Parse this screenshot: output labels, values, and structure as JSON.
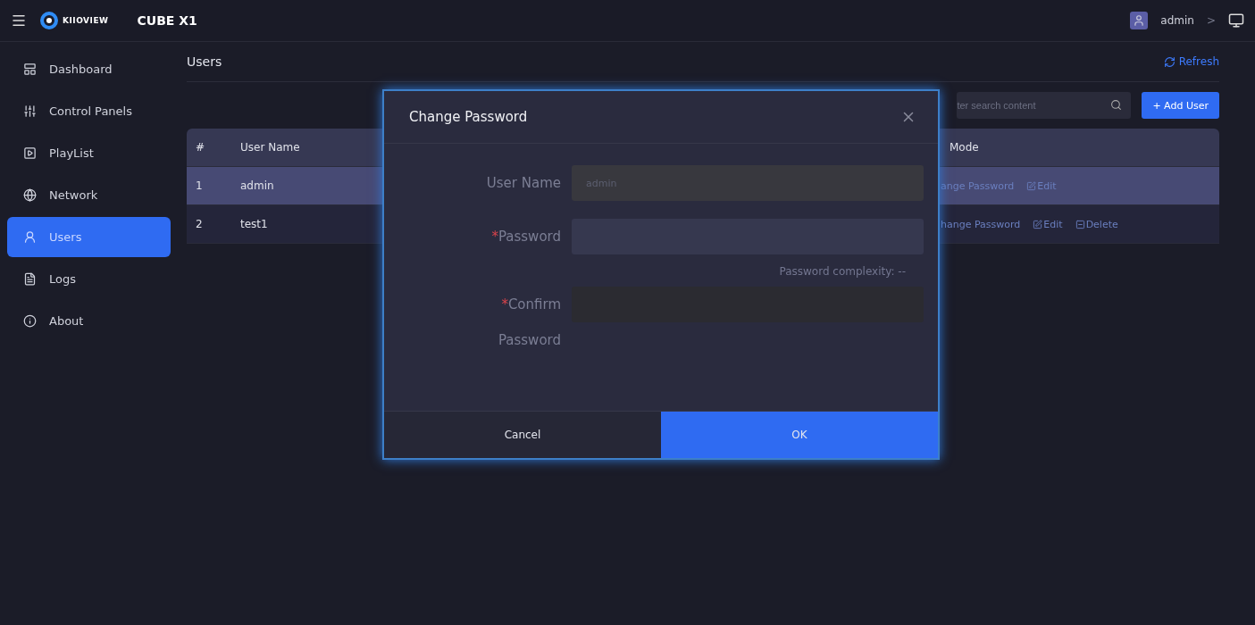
{
  "header": {
    "logo_text": "KIIOVIEW",
    "product": "CUBE X1",
    "user": "admin",
    "chevron": ">"
  },
  "sidebar": {
    "items": [
      {
        "label": "Dashboard",
        "selected": false
      },
      {
        "label": "Control Panels",
        "selected": false
      },
      {
        "label": "PlayList",
        "selected": false
      },
      {
        "label": "Network",
        "selected": false
      },
      {
        "label": "Users",
        "selected": true
      },
      {
        "label": "Logs",
        "selected": false
      },
      {
        "label": "About",
        "selected": false
      }
    ]
  },
  "page": {
    "title": "Users",
    "refresh": "Refresh",
    "search": {
      "placeholder": "ter search content"
    },
    "add_button": "+ Add User"
  },
  "table": {
    "columns": [
      "#",
      "User Name",
      "Mode"
    ],
    "rows": [
      {
        "cells": [
          "1",
          "admin"
        ],
        "selected": true,
        "actions": [
          {
            "kind": "text",
            "label": "ange Password"
          },
          {
            "kind": "edit",
            "label": "Edit"
          }
        ]
      },
      {
        "cells": [
          "2",
          "test1"
        ],
        "selected": false,
        "actions": [
          {
            "kind": "text",
            "label": "hange Password"
          },
          {
            "kind": "edit",
            "label": "Edit"
          },
          {
            "kind": "delete",
            "label": "Delete"
          }
        ]
      }
    ]
  },
  "dialog": {
    "title": "Change Password",
    "fields": [
      {
        "label": "User Name",
        "disabled": true,
        "value": "admin"
      },
      {
        "required_mark": "*",
        "label": "Password",
        "disabled": false
      },
      {
        "required_mark": "*",
        "label": "Confirm Password",
        "disabled": false
      }
    ],
    "complexity": "Password complexity: --",
    "cancel": "Cancel",
    "ok": "OK"
  }
}
